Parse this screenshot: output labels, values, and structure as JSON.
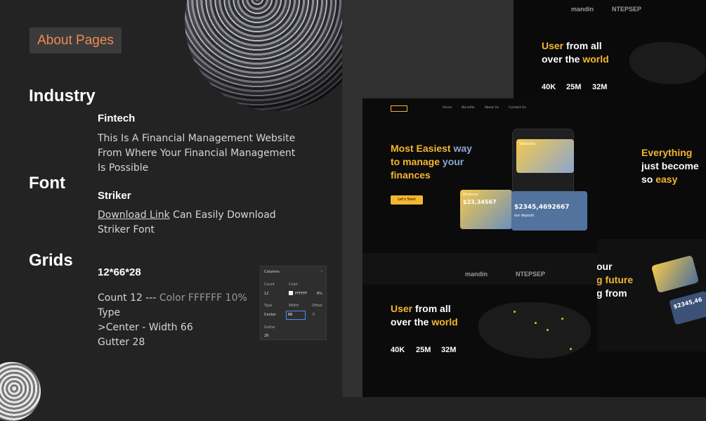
{
  "tag": "About Pages",
  "headings": {
    "industry": "Industry",
    "font": "Font",
    "grids": "Grids"
  },
  "industry": {
    "name": "Fintech",
    "line1": "This Is A Financial Management Website",
    "line2": "From Where Your Financial Management",
    "line3": "Is Possible"
  },
  "font": {
    "name": "Striker",
    "link": "Download Link",
    "rest1": " Can Easily Download",
    "rest2": "Striker Font"
  },
  "grids": {
    "spec": "12*66*28",
    "count_prefix": "Count 12 ---",
    "count_color": " Color FFFFFF 10%",
    "line2": "Type",
    "line3": ">Center - Width 66",
    "line4": "Gutter 28"
  },
  "panel": {
    "title": "Columns",
    "count_label": "Count",
    "count_value": "12",
    "color_label": "Color",
    "color_value": "FFFFFF",
    "color_pct": "6%",
    "type_label": "Type",
    "type_value": "Center",
    "width_label": "Width",
    "width_value": "66",
    "offset_label": "Offset",
    "offset_value": "0",
    "gutter_label": "Gutter",
    "gutter_value": "28"
  },
  "site": {
    "nav": [
      "Home",
      "Benefits",
      "About Us",
      "Contact Us"
    ],
    "hero": {
      "line1a": "Most Easiest ",
      "line1b": "way",
      "line2a": "to manage ",
      "line2b": "your",
      "line3": "finances",
      "cta": "Let's Start"
    },
    "cards": {
      "card1_name": "Tatiandsu",
      "revenue_label": "Revenue",
      "revenue_value": "$23,34567",
      "deposit_value": "$2345,4692667",
      "deposit_label": "our deposit"
    },
    "logos": [
      "mandin",
      "NTEPSEP"
    ],
    "world": {
      "a": "User ",
      "b": "from all",
      "c": "over the ",
      "d": "world"
    },
    "stats": [
      {
        "value": "40K"
      },
      {
        "value": "25M"
      },
      {
        "value": "32M"
      }
    ],
    "everything": {
      "l1": "Everything",
      "l2": "just become",
      "l3": "so ",
      "l4": "easy"
    },
    "future": {
      "l1": "our",
      "l2": "g future",
      "l3": "g from"
    },
    "card_small": "$2345,46"
  },
  "colors": {
    "accent": "#f5b630",
    "tag": "#f08a52"
  }
}
